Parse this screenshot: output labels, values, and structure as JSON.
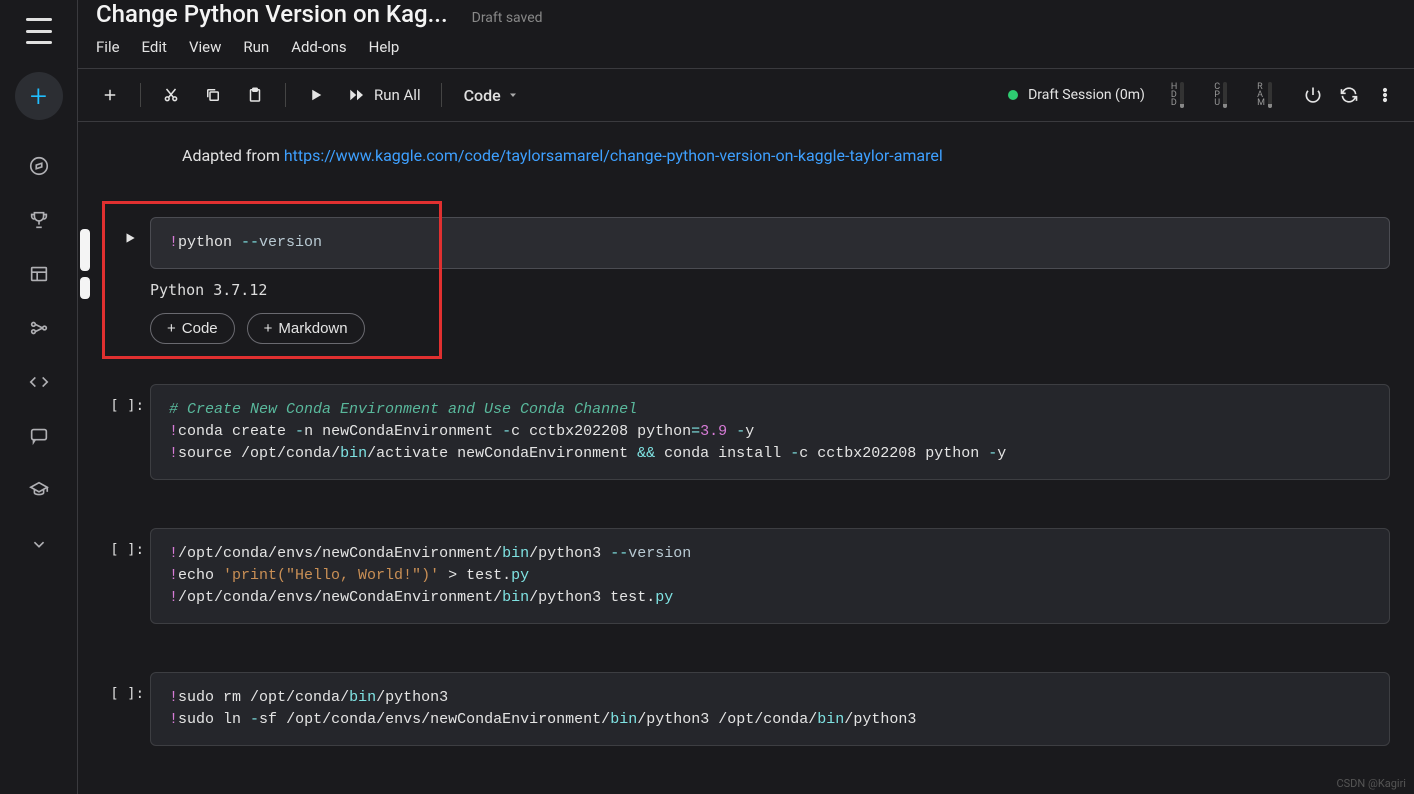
{
  "header": {
    "title": "Change Python Version on Kag...",
    "status": "Draft saved"
  },
  "menu": {
    "file": "File",
    "edit": "Edit",
    "view": "View",
    "run": "Run",
    "addons": "Add-ons",
    "help": "Help"
  },
  "toolbar": {
    "run_all": "Run All",
    "celltype": "Code",
    "session": "Draft Session (0m)",
    "meters": {
      "hdd": "HDD",
      "cpu": "CPU",
      "ram": "RAM"
    }
  },
  "intro": {
    "prefix": "Adapted from ",
    "link": "https://www.kaggle.com/code/taylorsamarel/change-python-version-on-kaggle-taylor-amarel"
  },
  "cells": [
    {
      "prompt": "",
      "code_html": "<span class='tok-bang'>!</span><span class='tok-cmd'>python </span><span class='tok-dashes'>--</span><span class='tok-flag'>version</span>",
      "output": "Python 3.7.12"
    },
    {
      "prompt": "[ ]:",
      "code_html": "<span class='tok-comment'># Create New Conda Environment and Use Conda Channel</span>\n<span class='tok-bang'>!</span><span class='tok-cmd'>conda create </span><span class='tok-dashes'>-</span><span class='tok-cmd'>n newCondaEnvironment </span><span class='tok-dashes'>-</span><span class='tok-cmd'>c cctbx202208 python</span><span class='tok-op'>=</span><span class='tok-num'>3.9</span> <span class='tok-dashes'>-</span><span class='tok-cmd'>y</span>\n<span class='tok-bang'>!</span><span class='tok-cmd'>source </span><span class='tok-path'>/opt/</span><span class='tok-cmd'>conda</span><span class='tok-path'>/</span><span class='tok-bin'>bin</span><span class='tok-path'>/</span><span class='tok-cmd'>activate newCondaEnvironment </span><span class='tok-op'>&amp;&amp;</span><span class='tok-cmd'> conda install </span><span class='tok-dashes'>-</span><span class='tok-cmd'>c cctbx202208 python </span><span class='tok-dashes'>-</span><span class='tok-cmd'>y</span>"
    },
    {
      "prompt": "[ ]:",
      "code_html": "<span class='tok-bang'>!</span><span class='tok-path'>/opt/</span><span class='tok-cmd'>conda</span><span class='tok-path'>/</span><span class='tok-cmd'>envs</span><span class='tok-path'>/</span><span class='tok-cmd'>newCondaEnvironment</span><span class='tok-path'>/</span><span class='tok-bin'>bin</span><span class='tok-path'>/</span><span class='tok-cmd'>python3 </span><span class='tok-dashes'>--</span><span class='tok-flag'>version</span>\n<span class='tok-bang'>!</span><span class='tok-cmd'>echo </span><span class='tok-str'>'print(\"Hello, World!\")'</span><span class='tok-cmd'> &gt; test.</span><span class='tok-ext'>py</span>\n<span class='tok-bang'>!</span><span class='tok-path'>/opt/</span><span class='tok-cmd'>conda</span><span class='tok-path'>/</span><span class='tok-cmd'>envs</span><span class='tok-path'>/</span><span class='tok-cmd'>newCondaEnvironment</span><span class='tok-path'>/</span><span class='tok-bin'>bin</span><span class='tok-path'>/</span><span class='tok-cmd'>python3 test.</span><span class='tok-ext'>py</span>"
    },
    {
      "prompt": "[ ]:",
      "code_html": "<span class='tok-bang'>!</span><span class='tok-cmd'>sudo rm </span><span class='tok-path'>/opt/</span><span class='tok-cmd'>conda</span><span class='tok-path'>/</span><span class='tok-bin'>bin</span><span class='tok-path'>/</span><span class='tok-cmd'>python3</span>\n<span class='tok-bang'>!</span><span class='tok-cmd'>sudo ln </span><span class='tok-dashes'>-</span><span class='tok-cmd'>sf </span><span class='tok-path'>/opt/</span><span class='tok-cmd'>conda</span><span class='tok-path'>/</span><span class='tok-cmd'>envs</span><span class='tok-path'>/</span><span class='tok-cmd'>newCondaEnvironment</span><span class='tok-path'>/</span><span class='tok-bin'>bin</span><span class='tok-path'>/</span><span class='tok-cmd'>python3 </span><span class='tok-path'>/opt/</span><span class='tok-cmd'>conda</span><span class='tok-path'>/</span><span class='tok-bin'>bin</span><span class='tok-path'>/</span><span class='tok-cmd'>python3</span>"
    }
  ],
  "add_buttons": {
    "code": "Code",
    "markdown": "Markdown"
  },
  "watermark": "CSDN @Kagiri"
}
